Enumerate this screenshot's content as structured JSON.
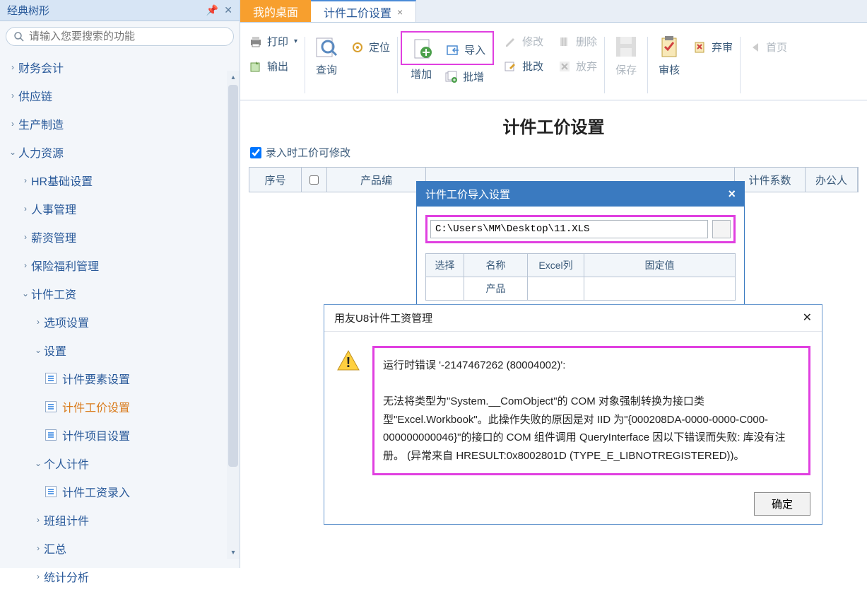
{
  "sidebar": {
    "title": "经典树形",
    "search_placeholder": "请输入您要搜索的功能",
    "items": {
      "finance": "财务会计",
      "supply": "供应链",
      "production": "生产制造",
      "hr": "人力资源",
      "hr_base": "HR基础设置",
      "hr_mgmt": "人事管理",
      "payroll": "薪资管理",
      "insurance": "保险福利管理",
      "piece_wage": "计件工资",
      "option_set": "选项设置",
      "settings": "设置",
      "element_set": "计件要素设置",
      "price_set": "计件工价设置",
      "project_set": "计件项目设置",
      "personal_piece": "个人计件",
      "wage_entry": "计件工资录入",
      "team_piece": "班组计件",
      "summary": "汇总",
      "stats": "统计分析"
    }
  },
  "tabs": {
    "desktop": "我的桌面",
    "current": "计件工价设置"
  },
  "toolbar": {
    "print": "打印",
    "export": "输出",
    "query": "查询",
    "locate": "定位",
    "add": "增加",
    "import": "导入",
    "modify": "修改",
    "batch_add": "批增",
    "batch_mod": "批改",
    "delete": "删除",
    "abandon": "放弃",
    "save": "保存",
    "audit": "审核",
    "reject": "弃审",
    "first": "首页"
  },
  "content": {
    "title": "计件工价设置",
    "checkbox_label": "录入时工价可修改",
    "cols": {
      "seq": "序号",
      "prod": "产品编",
      "coeff": "计件系数",
      "office": "办公人"
    }
  },
  "import_dialog": {
    "title": "计件工价导入设置",
    "path": "C:\\Users\\MM\\Desktop\\11.XLS",
    "cols": {
      "select": "选择",
      "name": "名称",
      "excel_col": "Excel列",
      "fixed": "固定值"
    },
    "row_product": "产品"
  },
  "error_dialog": {
    "title": "用友U8计件工资管理",
    "line1": "运行时错误 '-2147467262 (80004002)':",
    "line2": "无法将类型为\"System.__ComObject\"的 COM 对象强制转换为接口类型\"Excel.Workbook\"。此操作失败的原因是对 IID 为\"{000208DA-0000-0000-C000-000000000046}\"的接口的 COM 组件调用 QueryInterface 因以下错误而失败: 库没有注册。 (异常来自 HRESULT:0x8002801D (TYPE_E_LIBNOTREGISTERED))。",
    "ok": "确定"
  }
}
